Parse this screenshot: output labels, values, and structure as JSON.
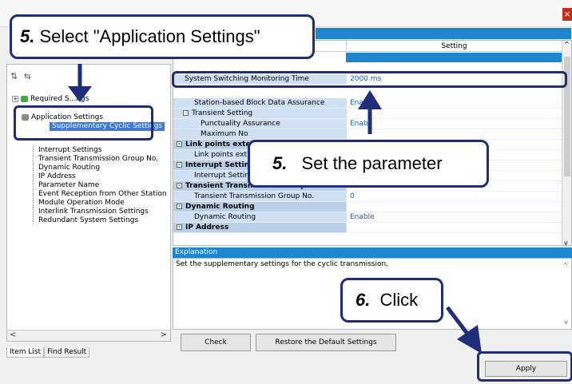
{
  "window": {
    "close_glyph": "×"
  },
  "tree": {
    "toolbar_glyphs": "⇅ ⇆",
    "items": [
      {
        "label": "Required Settings",
        "visible_fragment": "Required S...ngs"
      },
      {
        "label": "Application Settings"
      },
      {
        "label": "Supplementary Cyclic Settings"
      },
      {
        "label": "Interrupt Settings"
      },
      {
        "label": "Transient Transmission Group No."
      },
      {
        "label": "Dynamic Routing"
      },
      {
        "label": "IP Address"
      },
      {
        "label": "Parameter Name"
      },
      {
        "label": "Event Reception from Other Station"
      },
      {
        "label": "Module Operation Mode"
      },
      {
        "label": "Interlink Transmission Settings"
      },
      {
        "label": "Redundant System Settings"
      }
    ],
    "scroll_left": "<",
    "scroll_right": ">"
  },
  "tabs": {
    "item_list": "Item List",
    "find_result": "Find Result"
  },
  "grid": {
    "setting_header": "Setting",
    "rows": [
      {
        "name": "System Switching Monitoring Time",
        "value": "2000 ms",
        "kind": "row"
      },
      {
        "name": "Station-based Block Data Assurance",
        "value": "Enab",
        "kind": "row"
      },
      {
        "name": "Transient Setting",
        "value": "",
        "kind": "subsection"
      },
      {
        "name": "Punctuality Assurance",
        "value": "Enab",
        "kind": "row2"
      },
      {
        "name": "Maximum No",
        "value": "",
        "kind": "row2"
      },
      {
        "name": "Link points exte",
        "value": "",
        "kind": "section"
      },
      {
        "name": "Link points ext",
        "value": "",
        "kind": "row"
      },
      {
        "name": "Interrupt Setting",
        "value": "",
        "kind": "section"
      },
      {
        "name": "Interrupt Setting",
        "value": "",
        "kind": "row"
      },
      {
        "name": "Transient Transmission Group No.",
        "value": "",
        "kind": "section"
      },
      {
        "name": "Transient Transmission Group No.",
        "value": "0",
        "kind": "row"
      },
      {
        "name": "Dynamic Routing",
        "value": "",
        "kind": "section"
      },
      {
        "name": "Dynamic Routing",
        "value": "Enable",
        "kind": "row"
      },
      {
        "name": "IP Address",
        "value": "",
        "kind": "section"
      }
    ],
    "scroll_up": "^",
    "scroll_down": "v"
  },
  "explanation": {
    "header": "Explanation",
    "text": "Set the supplementary settings for the cyclic transmission.",
    "scroll_up": "^",
    "scroll_down": "v"
  },
  "buttons": {
    "check_label": "Check",
    "restore_label": "Restore the Default Settings",
    "apply_label": "Apply"
  },
  "callouts": {
    "select": {
      "num": "5.",
      "text": "Select \"Application Settings\""
    },
    "set": {
      "num": "5.",
      "text": "Set the parameter"
    },
    "click": {
      "num": "6.",
      "text": "Click"
    }
  },
  "colors": {
    "accent": "#1e86cf",
    "callout_border": "#1f2d7a",
    "selected": "#3d7ad6"
  }
}
